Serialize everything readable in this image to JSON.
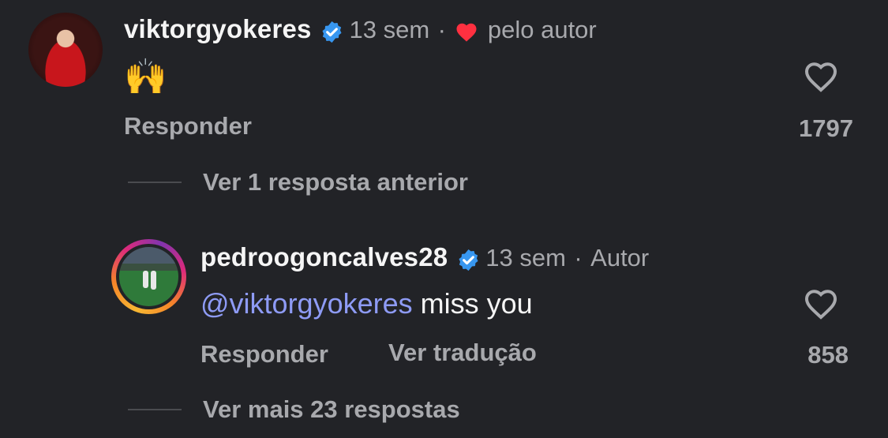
{
  "comment1": {
    "username": "viktorgyokeres",
    "time": "13 sem",
    "separator": "·",
    "liked_by_author": "pelo autor",
    "text": "🙌",
    "reply_label": "Responder",
    "like_count": "1797",
    "verified_icon": "verified-badge-icon",
    "heart_icon": "heart-outline-icon"
  },
  "previous_replies": "Ver 1 resposta anterior",
  "reply1": {
    "username": "pedroogoncalves28",
    "time": "13 sem",
    "separator": "·",
    "author_tag": "Autor",
    "mention": "@viktorgyokeres",
    "text": " miss you",
    "reply_label": "Responder",
    "translate_label": "Ver tradução",
    "like_count": "858"
  },
  "more_replies": "Ver mais 23 respostas",
  "colors": {
    "background": "#222327",
    "mention": "#8e9bf5",
    "verified": "#3897f0",
    "liked_heart": "#ff3040"
  }
}
